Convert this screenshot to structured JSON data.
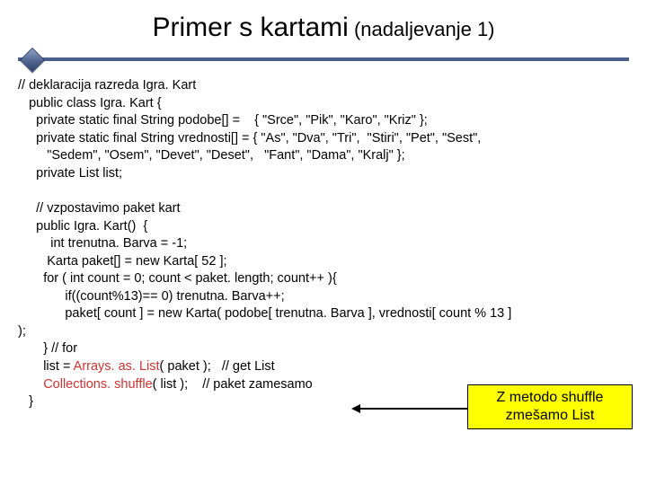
{
  "title": {
    "main": "Primer s kartami",
    "sub": " (nadaljevanje 1)"
  },
  "code": {
    "l01": "// deklaracija razreda Igra. Kart",
    "l02": "   public class Igra. Kart {",
    "l03": "     private static final String podobe[] =    { \"Srce\", \"Pik\", \"Karo\", \"Kriz\" };",
    "l04": "     private static final String vrednosti[] = { \"As\", \"Dva\", \"Tri\",  \"Stiri\", \"Pet\", \"Sest\",",
    "l05": "        \"Sedem\", \"Osem\", \"Devet\", \"Deset\",   \"Fant\", \"Dama\", \"Kralj\" };",
    "l06": "     private List list;",
    "l07": "     // vzpostavimo paket kart",
    "l08": "     public Igra. Kart()  {",
    "l09": "         int trenutna. Barva = -1;",
    "l10": "        Karta paket[] = new Karta[ 52 ];",
    "l11": "       for ( int count = 0; count < paket. length; count++ ){",
    "l12": "             if((count%13)== 0) trenutna. Barva++;",
    "l13": "             paket[ count ] = new Karta( podobe[ trenutna. Barva ], vrednosti[ count % 13 ]",
    "l14": ");",
    "l15": "       } // for",
    "l16a": "       list = ",
    "l16b": "Arrays. as. List",
    "l16c": "( paket );   // get List",
    "l17a": "       ",
    "l17b": "Collections. shuffle",
    "l17c": "( list );    // paket zamesamo",
    "l18": "   }"
  },
  "callout": {
    "line1": "Z metodo shuffle",
    "line2": "zmešamo List"
  }
}
